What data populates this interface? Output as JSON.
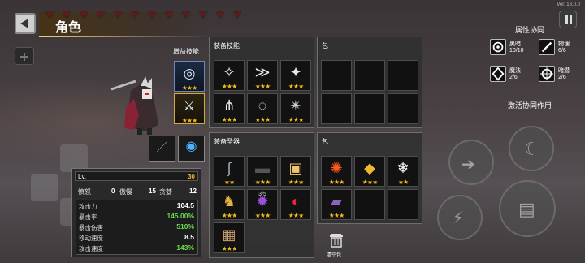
{
  "header": {
    "title": "角色",
    "version": "Ver. 18.0.0",
    "hearts_count": 12,
    "heart_color": "#5a1e1e"
  },
  "boost_skills": {
    "label": "增益技能",
    "slots": [
      {
        "icon": "shield-orb-icon",
        "stars": "★★★"
      },
      {
        "icon": "twin-swords-icon",
        "stars": "★★★"
      }
    ]
  },
  "weapons": [
    {
      "icon": "sword-icon",
      "stars": ""
    },
    {
      "icon": "vortex-icon",
      "stars": ""
    }
  ],
  "equip_skills": {
    "label": "装备技能",
    "items": [
      {
        "icon": "wing-icon",
        "stars": "★★★"
      },
      {
        "icon": "dash-icon",
        "stars": "★★★"
      },
      {
        "icon": "shuriken-icon",
        "stars": "★★★"
      },
      {
        "icon": "claw-icon",
        "stars": "★★★"
      },
      {
        "icon": "ring-icon",
        "stars": "★★★"
      },
      {
        "icon": "star-burst-icon",
        "stars": "★★★"
      }
    ]
  },
  "skill_bag": {
    "label": "包",
    "slots": 6
  },
  "equip_relics": {
    "label": "装备圣器",
    "items": [
      {
        "icon": "cane-icon",
        "stars": "★★",
        "badge": ""
      },
      {
        "icon": "dark-bar-icon",
        "stars": "★★★",
        "badge": ""
      },
      {
        "icon": "scroll-icon",
        "stars": "★★★",
        "badge": ""
      },
      {
        "icon": "golden-deer-icon",
        "stars": "★★★",
        "badge": ""
      },
      {
        "icon": "purple-crystal-icon",
        "stars": "★★★",
        "badge": "3/5"
      },
      {
        "icon": "red-horn-icon",
        "stars": "★★★",
        "badge": ""
      },
      {
        "icon": "treasure-box-icon",
        "stars": "★★★",
        "badge": ""
      }
    ]
  },
  "relic_bag": {
    "label": "包",
    "items": [
      {
        "icon": "fire-orb-icon",
        "stars": "★★★"
      },
      {
        "icon": "golden-cube-icon",
        "stars": "★★★"
      },
      {
        "icon": "snowflake-icon",
        "stars": "★★"
      },
      {
        "icon": "purple-chest-icon",
        "stars": "★★★"
      }
    ],
    "slots": 8
  },
  "clear_bag": {
    "label": "清空包"
  },
  "stats": {
    "level_label": "Lv.",
    "level": "30",
    "row3": [
      {
        "label": "愤怒",
        "value": "0"
      },
      {
        "label": "傲慢",
        "value": "15"
      },
      {
        "label": "贪婪",
        "value": "12"
      }
    ],
    "list": [
      {
        "label": "攻击力",
        "value": "104.5",
        "green": false
      },
      {
        "label": "暴击率",
        "value": "145.00%",
        "green": true
      },
      {
        "label": "暴击伤害",
        "value": "510%",
        "green": true
      },
      {
        "label": "移动速度",
        "value": "8.5",
        "green": false
      },
      {
        "label": "攻击速度",
        "value": "143%",
        "green": true
      }
    ]
  },
  "attributes": {
    "title": "属性协同",
    "items": [
      {
        "name": "黑暗",
        "value": "10/10",
        "icon": "dark-swirl-icon"
      },
      {
        "name": "物理",
        "value": "6/6",
        "icon": "blade-icon"
      },
      {
        "name": "魔法",
        "value": "2/6",
        "icon": "magic-diamond-icon"
      },
      {
        "name": "暗潜",
        "value": "2/6",
        "icon": "crosshair-icon"
      }
    ],
    "synergy_label": "激活协同作用"
  },
  "colors": {
    "gold": "#f2b922",
    "green": "#6bd84d",
    "panel": "#303030"
  }
}
